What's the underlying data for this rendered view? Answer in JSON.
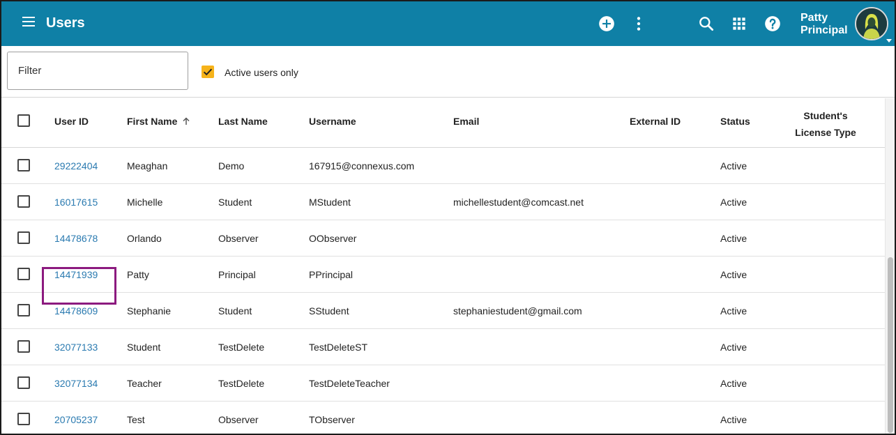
{
  "header": {
    "title": "Users",
    "user_first": "Patty",
    "user_last": "Principal",
    "icons": [
      "menu-icon",
      "add-circle-icon",
      "more-vert-icon",
      "search-icon",
      "apps-grid-icon",
      "help-icon",
      "chevron-down-icon"
    ],
    "color": "#0f80a6"
  },
  "filter": {
    "placeholder": "Filter",
    "value": "",
    "active_only_label": "Active users only",
    "active_only_checked": true,
    "check_color": "#f6b31b"
  },
  "table": {
    "headers": {
      "user_id": "User ID",
      "first_name": "First Name",
      "last_name": "Last Name",
      "username": "Username",
      "email": "Email",
      "external_id": "External ID",
      "status": "Status",
      "license_line1": "Student's",
      "license_line2": "License Type"
    },
    "sort": {
      "column": "First Name",
      "direction": "ascending"
    },
    "link_color": "#2a7ab0",
    "rows": [
      {
        "user_id": "29222404",
        "first_name": "Meaghan",
        "last_name": "Demo",
        "username": "167915@connexus.com",
        "email": "",
        "external_id": "",
        "status": "Active",
        "license": ""
      },
      {
        "user_id": "16017615",
        "first_name": "Michelle",
        "last_name": "Student",
        "username": "MStudent",
        "email": "michellestudent@comcast.net",
        "external_id": "",
        "status": "Active",
        "license": ""
      },
      {
        "user_id": "14478678",
        "first_name": "Orlando",
        "last_name": "Observer",
        "username": "OObserver",
        "email": "",
        "external_id": "",
        "status": "Active",
        "license": ""
      },
      {
        "user_id": "14471939",
        "first_name": "Patty",
        "last_name": "Principal",
        "username": "PPrincipal",
        "email": "",
        "external_id": "",
        "status": "Active",
        "license": ""
      },
      {
        "user_id": "14478609",
        "first_name": "Stephanie",
        "last_name": "Student",
        "username": "SStudent",
        "email": "stephaniestudent@gmail.com",
        "external_id": "",
        "status": "Active",
        "license": ""
      },
      {
        "user_id": "32077133",
        "first_name": "Student",
        "last_name": "TestDelete",
        "username": "TestDeleteST",
        "email": "",
        "external_id": "",
        "status": "Active",
        "license": ""
      },
      {
        "user_id": "32077134",
        "first_name": "Teacher",
        "last_name": "TestDelete",
        "username": "TestDeleteTeacher",
        "email": "",
        "external_id": "",
        "status": "Active",
        "license": ""
      },
      {
        "user_id": "20705237",
        "first_name": "Test",
        "last_name": "Observer",
        "username": "TObserver",
        "email": "",
        "external_id": "",
        "status": "Active",
        "license": ""
      }
    ],
    "highlight_color": "#8c1a7f"
  }
}
